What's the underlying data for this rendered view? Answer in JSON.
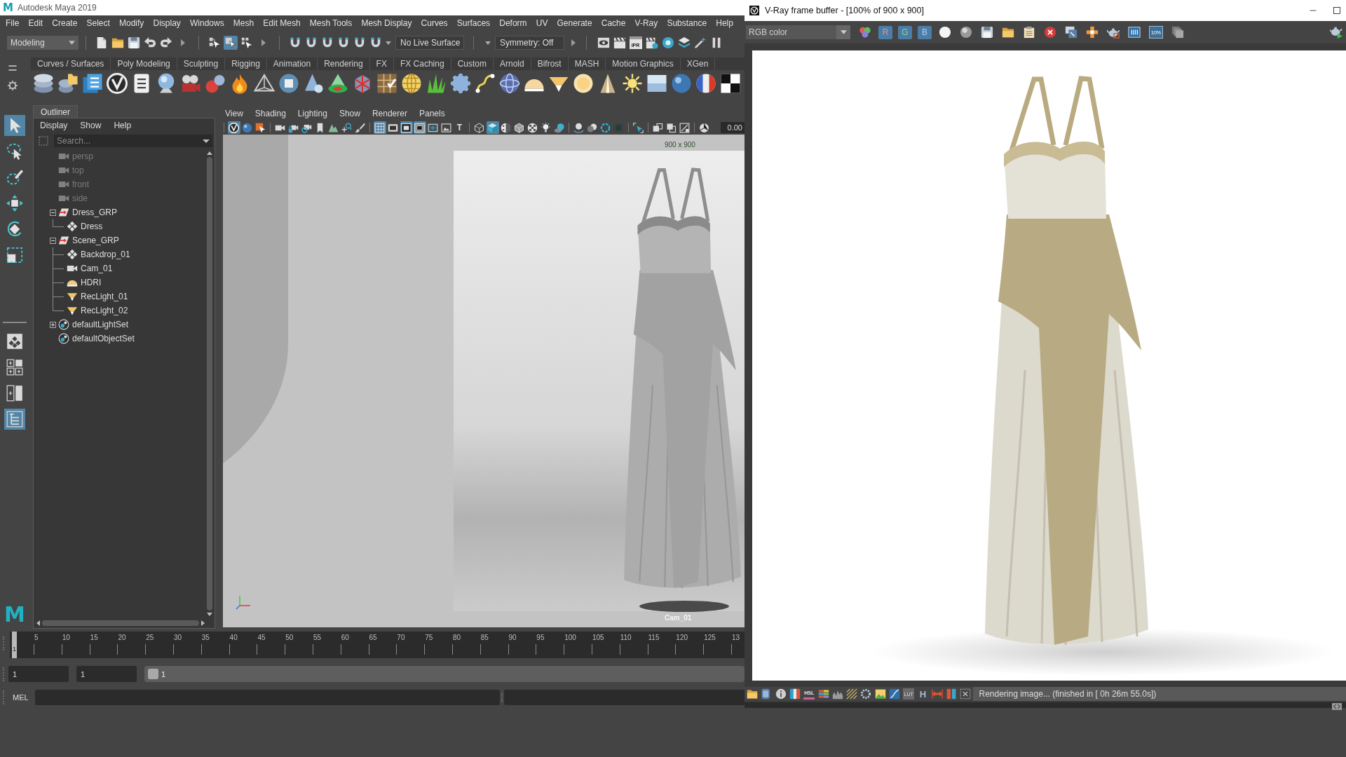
{
  "maya_window": {
    "logo": "M",
    "title": "Autodesk Maya 2019"
  },
  "menu_bar": [
    "File",
    "Edit",
    "Create",
    "Select",
    "Modify",
    "Display",
    "Windows",
    "Mesh",
    "Edit Mesh",
    "Mesh Tools",
    "Mesh Display",
    "Curves",
    "Surfaces",
    "Deform",
    "UV",
    "Generate",
    "Cache",
    "V-Ray",
    "Substance",
    "Help"
  ],
  "status_line": {
    "workspace": "Modeling",
    "selection_modes": [
      {
        "selected": false
      },
      {
        "selected": true
      },
      {
        "selected": false
      }
    ],
    "live_surface": "No Live Surface",
    "symmetry": "Symmetry: Off",
    "ipr_label": "IPR"
  },
  "shelf": {
    "tabs": [
      {
        "label": "Curves / Surfaces",
        "selected": false
      },
      {
        "label": "Poly Modeling",
        "selected": false
      },
      {
        "label": "Sculpting",
        "selected": false
      },
      {
        "label": "Rigging",
        "selected": false
      },
      {
        "label": "Animation",
        "selected": false
      },
      {
        "label": "Rendering",
        "selected": false
      },
      {
        "label": "FX",
        "selected": false
      },
      {
        "label": "FX Caching",
        "selected": false
      },
      {
        "label": "Custom",
        "selected": false
      },
      {
        "label": "Arnold",
        "selected": false
      },
      {
        "label": "Bifrost",
        "selected": false
      },
      {
        "label": "MASH",
        "selected": false
      },
      {
        "label": "Motion Graphics",
        "selected": false
      },
      {
        "label": "XGen",
        "selected": false
      }
    ]
  },
  "toolbox": {
    "tools": [
      {
        "selected": true
      },
      {
        "selected": false
      },
      {
        "selected": false
      },
      {
        "selected": false
      },
      {
        "selected": false
      },
      {
        "selected": false
      }
    ],
    "layouts": [
      {
        "selected": false
      },
      {
        "selected": false
      },
      {
        "selected": false
      },
      {
        "selected": true
      }
    ],
    "logo": "M"
  },
  "outliner": {
    "tab": "Outliner",
    "menus": [
      "Display",
      "Show",
      "Help"
    ],
    "search": {
      "placeholder": "Search..."
    },
    "items": [
      {
        "label": "persp",
        "kind": "camera",
        "hidden": true
      },
      {
        "label": "top",
        "kind": "camera",
        "hidden": true
      },
      {
        "label": "front",
        "kind": "camera",
        "hidden": true
      },
      {
        "label": "side",
        "kind": "camera",
        "hidden": true
      },
      {
        "label": "Dress_GRP",
        "kind": "group",
        "hidden": false,
        "expanded": true,
        "children": [
          {
            "label": "Dress",
            "kind": "mesh",
            "hidden": false
          }
        ]
      },
      {
        "label": "Scene_GRP",
        "kind": "group",
        "hidden": false,
        "expanded": true,
        "children": [
          {
            "label": "Backdrop_01",
            "kind": "mesh",
            "hidden": false
          },
          {
            "label": "Cam_01",
            "kind": "camera",
            "hidden": false
          },
          {
            "label": "HDRI",
            "kind": "dome_light",
            "hidden": false
          },
          {
            "label": "RecLight_01",
            "kind": "rect_light",
            "hidden": false
          },
          {
            "label": "RecLight_02",
            "kind": "rect_light",
            "hidden": false
          }
        ]
      },
      {
        "label": "defaultLightSet",
        "kind": "set",
        "hidden": false,
        "expanded": false
      },
      {
        "label": "defaultObjectSet",
        "kind": "set",
        "hidden": false
      }
    ]
  },
  "viewport": {
    "menus": [
      "View",
      "Shading",
      "Lighting",
      "Show",
      "Renderer",
      "Panels"
    ],
    "toolbar_buttons": [
      {
        "on": true
      },
      {
        "on": false
      },
      {
        "on": false
      },
      {
        "on": false
      },
      {
        "on": false
      },
      {
        "on": false
      },
      {
        "on": false
      },
      {
        "on": false
      },
      {
        "on": false
      },
      {
        "on": false
      },
      {
        "on": true
      },
      {
        "on": false
      },
      {
        "on": true
      },
      {
        "on": true
      },
      {
        "on": false
      },
      {
        "on": false
      },
      {
        "on": false,
        "label": "T"
      },
      {
        "on": false
      },
      {
        "on": true
      },
      {
        "on": false
      },
      {
        "on": false
      },
      {
        "on": false
      },
      {
        "on": false
      },
      {
        "on": false
      },
      {
        "on": false
      },
      {
        "on": false
      },
      {
        "on": false
      },
      {
        "on": false
      },
      {
        "on": false
      },
      {
        "on": false
      },
      {
        "on": false
      },
      {
        "on": false
      },
      {
        "on": false
      }
    ],
    "exposure": "0.00",
    "resolution": "900 x 900",
    "camera": "Cam_01"
  },
  "time_slider": {
    "current_frame": "1",
    "level": 0,
    "frame_labels": [
      "5",
      "10",
      "15",
      "20",
      "25",
      "30",
      "35",
      "40",
      "45",
      "50",
      "55",
      "60",
      "65",
      "70",
      "75",
      "80",
      "85",
      "90",
      "95",
      "100",
      "105",
      "110",
      "115",
      "120",
      "125",
      "13"
    ]
  },
  "range_slider": {
    "start": "1",
    "playback_start": "1",
    "level": 0,
    "range_label": "1"
  },
  "command_line": {
    "language": "MEL"
  },
  "vfb_window": {
    "title": "V-Ray frame buffer - [100% of 900 x 900]",
    "channel": "RGB color",
    "channel_buttons": [
      {
        "label": "R",
        "on": true
      },
      {
        "label": "G",
        "on": true
      },
      {
        "label": "B",
        "on": true
      }
    ],
    "zoom_badge": "10%",
    "status_badges": [
      "HSL",
      "LUT",
      "H"
    ],
    "status": "Rendering image... (finished in [ 0h 26m 55.0s])"
  }
}
